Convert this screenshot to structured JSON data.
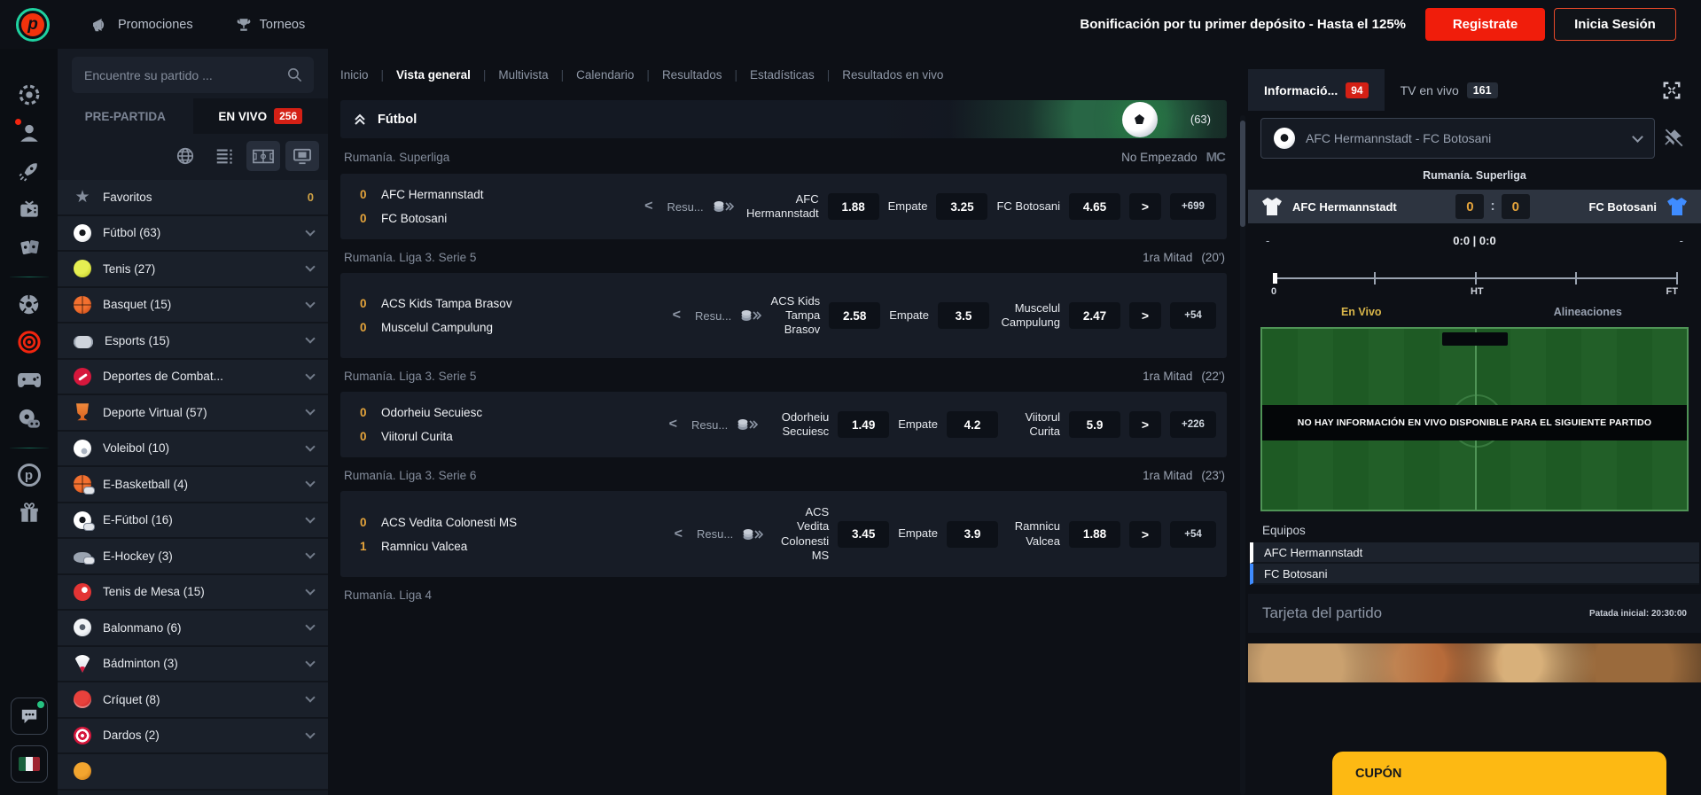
{
  "topbar": {
    "promos": "Promociones",
    "torneos": "Torneos",
    "bonus": "Bonificación por tu primer depósito - Hasta el 125%",
    "register": "Registrate",
    "login": "Inicia Sesión"
  },
  "sidebar": {
    "search_placeholder": "Encuentre su partido ...",
    "tab_prematch": "PRE-PARTIDA",
    "tab_live": "EN VIVO",
    "live_count": "256",
    "favorites": {
      "label": "Favoritos",
      "count": "0"
    },
    "sports": [
      {
        "label": "Fútbol (63)",
        "icon": "football-icon"
      },
      {
        "label": "Tenis (27)",
        "icon": "tennis-icon"
      },
      {
        "label": "Basquet (15)",
        "icon": "basketball-icon"
      },
      {
        "label": "Esports (15)",
        "icon": "esports-icon"
      },
      {
        "label": "Deportes de Combat...",
        "icon": "combat-sports-icon"
      },
      {
        "label": "Deporte Virtual (57)",
        "icon": "virtual-sport-icon"
      },
      {
        "label": "Voleibol (10)",
        "icon": "volleyball-icon"
      },
      {
        "label": "E-Basketball (4)",
        "icon": "e-basketball-icon"
      },
      {
        "label": "E-Fútbol (16)",
        "icon": "e-football-icon"
      },
      {
        "label": "E-Hockey (3)",
        "icon": "e-hockey-icon"
      },
      {
        "label": "Tenis de Mesa (15)",
        "icon": "table-tennis-icon"
      },
      {
        "label": "Balonmano (6)",
        "icon": "handball-icon"
      },
      {
        "label": "Bádminton (3)",
        "icon": "badminton-icon"
      },
      {
        "label": "Críquet (8)",
        "icon": "cricket-icon"
      },
      {
        "label": "Dardos (2)",
        "icon": "darts-icon"
      }
    ]
  },
  "nav": {
    "items": [
      "Inicio",
      "Vista general",
      "Multivista",
      "Calendario",
      "Resultados",
      "Estadísticas",
      "Resultados en vivo"
    ],
    "active": "Vista general"
  },
  "main": {
    "sport_header": {
      "title": "Fútbol",
      "count": "(63)"
    },
    "groups": [
      {
        "league": "Rumanía. Superliga",
        "status": "No Empezado",
        "logo": "MC",
        "match": {
          "s1": "0",
          "t1": "AFC Hermannstadt",
          "s2": "0",
          "t2": "FC Botosani",
          "mcat": "Resu...",
          "m1": "AFC Hermannstadt",
          "o1": "1.88",
          "mx": "Empate",
          "ox": "3.25",
          "m2": "FC Botosani",
          "o2": "4.65",
          "more": "+699"
        }
      },
      {
        "league": "Rumanía. Liga 3. Serie 5",
        "status": "1ra Mitad",
        "time": "(20')",
        "match": {
          "s1": "0",
          "t1": "ACS Kids Tampa Brasov",
          "s2": "0",
          "t2": "Muscelul Campulung",
          "mcat": "Resu...",
          "m1": "ACS Kids Tampa Brasov",
          "o1": "2.58",
          "mx": "Empate",
          "ox": "3.5",
          "m2": "Muscelul Campulung",
          "o2": "2.47",
          "more": "+54"
        }
      },
      {
        "league": "Rumanía. Liga 3. Serie 5",
        "status": "1ra Mitad",
        "time": "(22')",
        "match": {
          "s1": "0",
          "t1": "Odorheiu Secuiesc",
          "s2": "0",
          "t2": "Viitorul Curita",
          "mcat": "Resu...",
          "m1": "Odorheiu Secuiesc",
          "o1": "1.49",
          "mx": "Empate",
          "ox": "4.2",
          "m2": "Viitorul Curita",
          "o2": "5.9",
          "more": "+226"
        }
      },
      {
        "league": "Rumanía. Liga 3. Serie 6",
        "status": "1ra Mitad",
        "time": "(23')",
        "match": {
          "s1": "0",
          "t1": "ACS Vedita Colonesti MS",
          "s2": "1",
          "t2": "Ramnicu Valcea",
          "mcat": "Resu...",
          "m1": "ACS Vedita Colonesti MS",
          "o1": "3.45",
          "mx": "Empate",
          "ox": "3.9",
          "m2": "Ramnicu Valcea",
          "o2": "1.88",
          "more": "+54"
        }
      },
      {
        "league": "Rumanía. Liga 4"
      }
    ]
  },
  "panel": {
    "tab_info": "Informació...",
    "info_count": "94",
    "tab_tv": "TV en vivo",
    "tv_count": "161",
    "selector_label": "AFC Hermannstadt - FC Botosani",
    "league": "Rumanía. Superliga",
    "score": {
      "t1": "AFC Hermannstadt",
      "s1": "0",
      "s2": "0",
      "t2": "FC Botosani",
      "left_dash": "-",
      "detail": "0:0 | 0:0",
      "right_dash": "-"
    },
    "timeline": {
      "start": "0",
      "ht": "HT",
      "ft": "FT"
    },
    "subtab_live": "En Vivo",
    "subtab_lineups": "Alineaciones",
    "no_info": "NO HAY INFORMACIÓN EN VIVO DISPONIBLE PARA EL SIGUIENTE PARTIDO",
    "teams_header": "Equipos",
    "team1": "AFC Hermannstadt",
    "team2": "FC Botosani",
    "match_card": "Tarjeta del partido",
    "kickoff": "Patada inicial: 20:30:00",
    "coupon": "CUPÓN"
  },
  "colors": {
    "accent_red": "#f01d0b",
    "accent_yellow": "#fdb913",
    "live_badge": "#d42015",
    "team2_bar": "#3f8cff"
  }
}
